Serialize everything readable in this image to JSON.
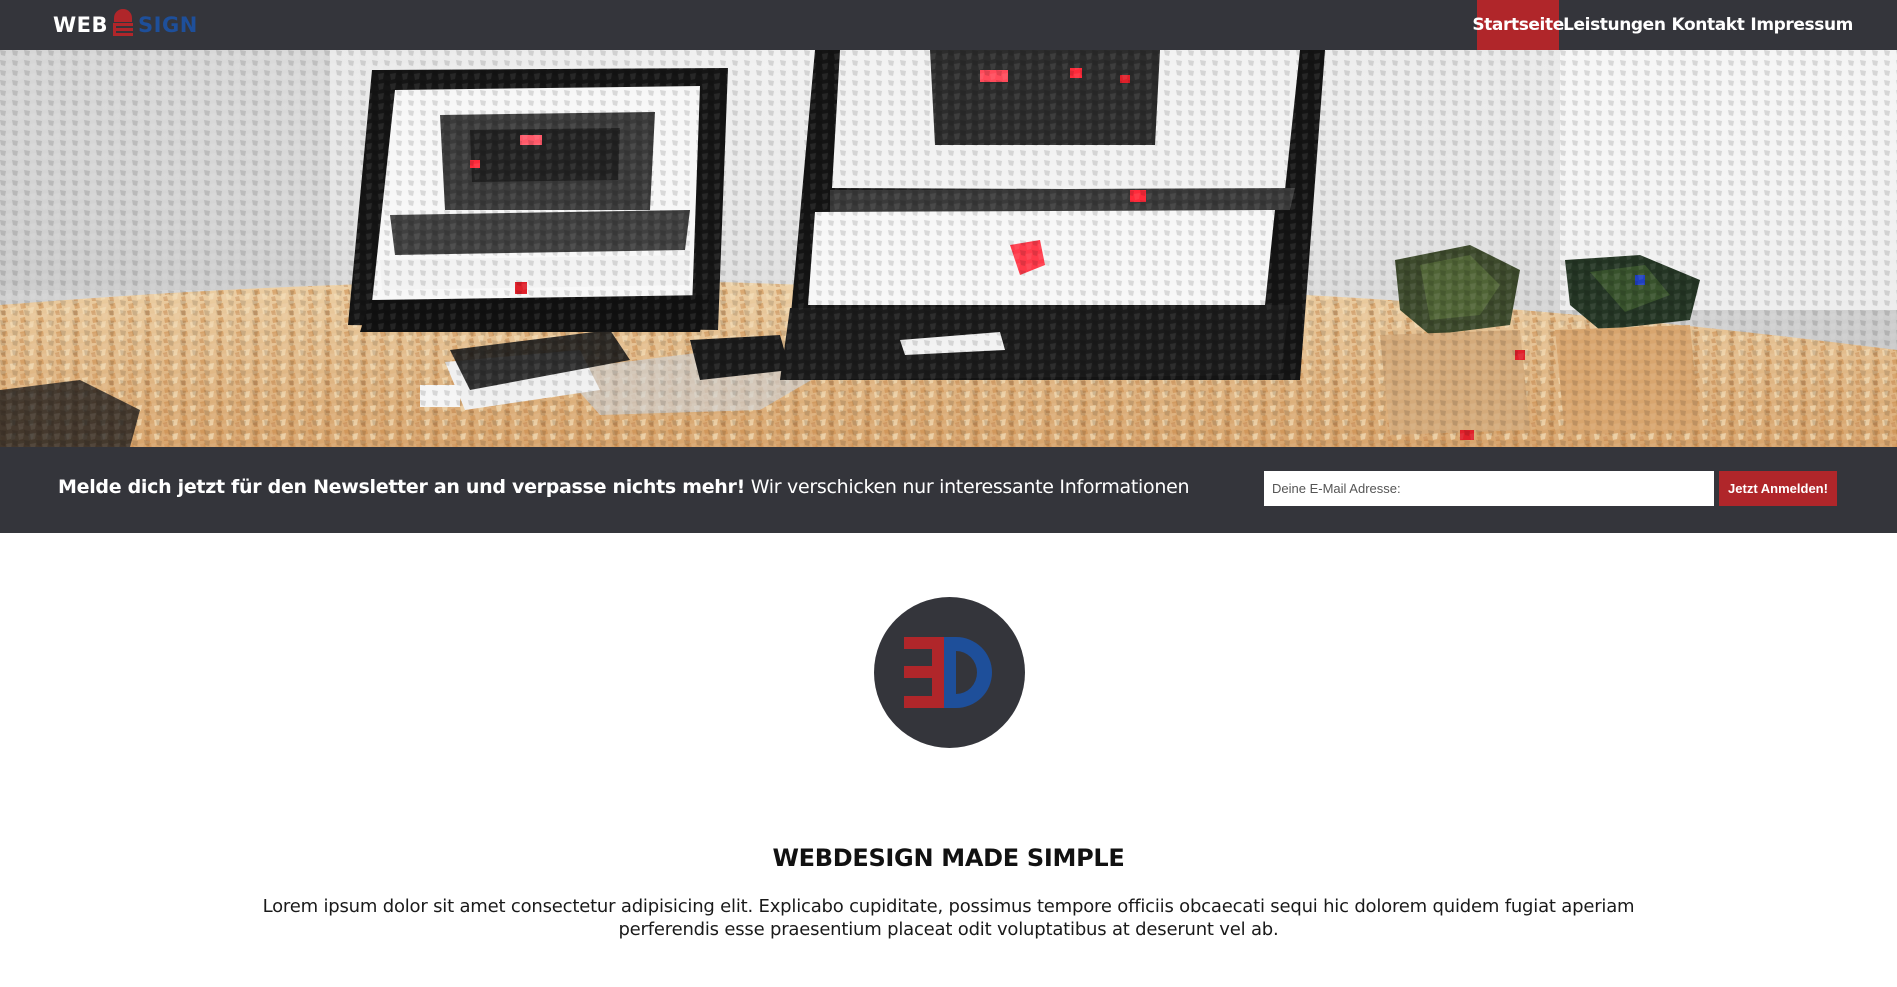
{
  "header": {
    "logo": {
      "part1": "WEB",
      "part2": "SIGN"
    },
    "nav": [
      {
        "label": "Startseite",
        "active": true
      },
      {
        "label": "Leistungen",
        "active": false
      },
      {
        "label": "Kontakt",
        "active": false
      },
      {
        "label": "Impressum",
        "active": false
      }
    ]
  },
  "newsletter": {
    "lead": "Melde dich jetzt für den Newsletter an und verpasse nichts mehr!",
    "text": "Wir verschicken nur interessante Informationen",
    "placeholder": "Deine E-Mail Adresse:",
    "button": "Jetzt Anmelden!"
  },
  "main": {
    "headline": "WEBDESIGN MADE SIMPLE",
    "text": "Lorem ipsum dolor sit amet consectetur adipisicing elit. Explicabo cupiditate, possimus tempore officiis obcaecati sequi hic dolorem quidem fugiat aperiam perferendis esse praesentium placeat odit voluptatibus at deserunt vel ab."
  },
  "colors": {
    "dark": "#34353b",
    "accent_red": "#b0262a",
    "accent_blue": "#1e4f9a"
  },
  "icons": {
    "logo_mark": "ed-monogram-icon",
    "badge": "ed-monogram-icon"
  }
}
